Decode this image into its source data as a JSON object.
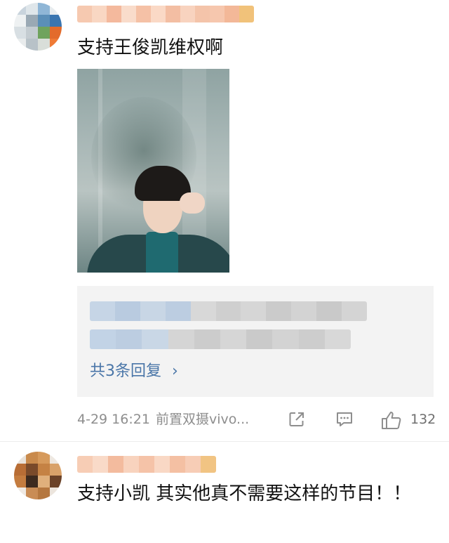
{
  "comments": [
    {
      "text": "支持王俊凯维权啊",
      "replies": {
        "count_label": "共3条回复",
        "chevron": "›"
      },
      "meta": {
        "time": "4-29 16:21",
        "device": "前置双摄vivo...",
        "like_count": "132"
      },
      "icons": [
        "share-icon",
        "comment-icon",
        "like-icon"
      ]
    },
    {
      "text": "支持小凯 其实他真不需要这样的节目！！"
    }
  ],
  "colors": {
    "link": "#4a76a8",
    "meta": "#8e8e8e",
    "reply_bg": "#f3f3f3"
  }
}
